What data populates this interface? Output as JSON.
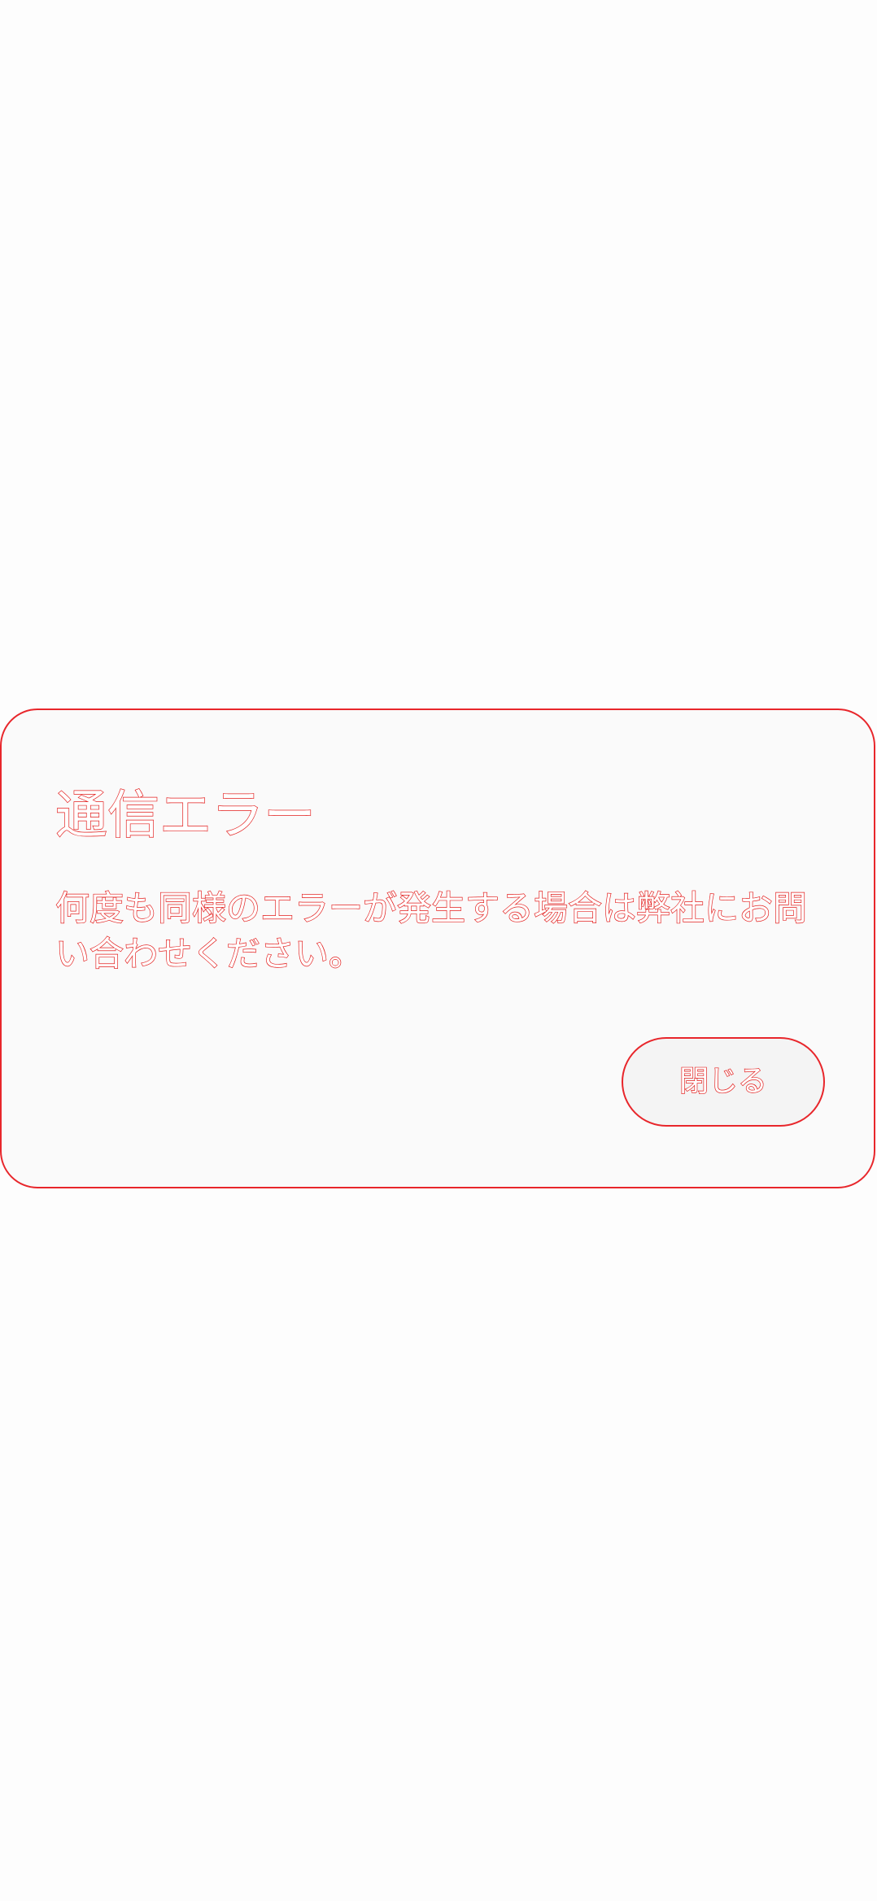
{
  "dialog": {
    "title": "通信エラー",
    "message": "何度も同様のエラーが発生する場合は弊社にお問い合わせください。",
    "close_label": "閉じる"
  },
  "colors": {
    "accent_outline": "#e8262b",
    "background": "#fdfdfd",
    "dialog_background": "#fafafa",
    "button_background": "#f4f4f4"
  }
}
